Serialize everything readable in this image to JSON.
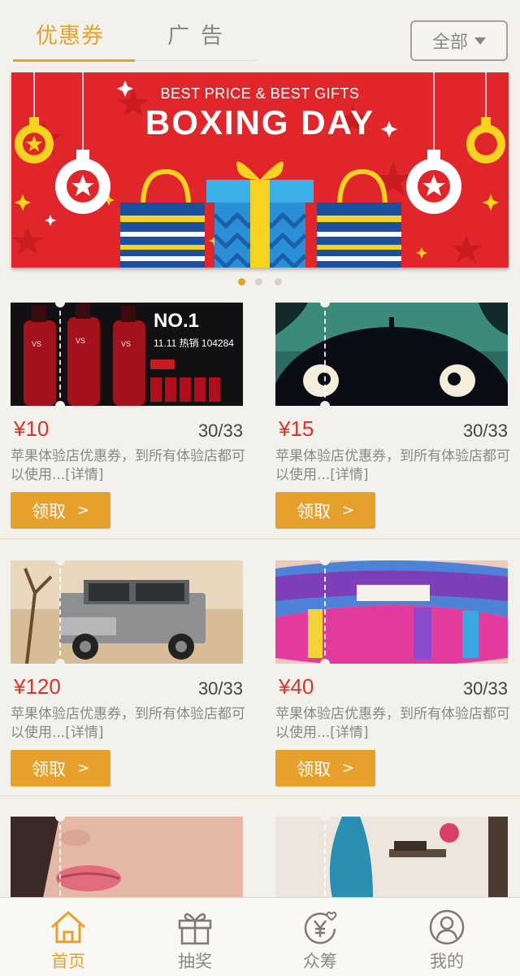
{
  "tabs": [
    {
      "label": "优惠券",
      "active": true
    },
    {
      "label": "广告",
      "active": false
    }
  ],
  "filter": {
    "label": "全部"
  },
  "banner": {
    "subtitle": "BEST PRICE & BEST GIFTS",
    "title": "BOXING DAY",
    "slides": 3,
    "active_slide": 1
  },
  "coupons": [
    {
      "price": "¥10",
      "stock": "30/33",
      "desc": "苹果体验店优惠券，到所有体验店都可以使用...[详情]",
      "button": "领取",
      "image": "shampoo-bottles-ad"
    },
    {
      "price": "¥15",
      "stock": "30/33",
      "desc": "苹果体验店优惠券，到所有体验店都可以使用...[详情]",
      "button": "领取",
      "image": "totoro-night-scene"
    },
    {
      "price": "¥120",
      "stock": "30/33",
      "desc": "苹果体验店优惠券，到所有体验店都可以使用...[详情]",
      "button": "领取",
      "image": "silver-suv"
    },
    {
      "price": "¥40",
      "stock": "30/33",
      "desc": "苹果体验店优惠券，到所有体验店都可以使用...[详情]",
      "button": "领取",
      "image": "colorful-lips"
    },
    {
      "image": "pink-lips-portrait"
    },
    {
      "image": "boutique-interior"
    }
  ],
  "bottom_nav": [
    {
      "label": "首页",
      "icon": "home-icon",
      "active": true
    },
    {
      "label": "抽奖",
      "icon": "gift-icon",
      "active": false
    },
    {
      "label": "众筹",
      "icon": "crowdfund-icon",
      "active": false
    },
    {
      "label": "我的",
      "icon": "user-icon",
      "active": false
    }
  ],
  "colors": {
    "accent": "#e8a02c",
    "price": "#d4352c",
    "banner_red": "#e0262a"
  }
}
